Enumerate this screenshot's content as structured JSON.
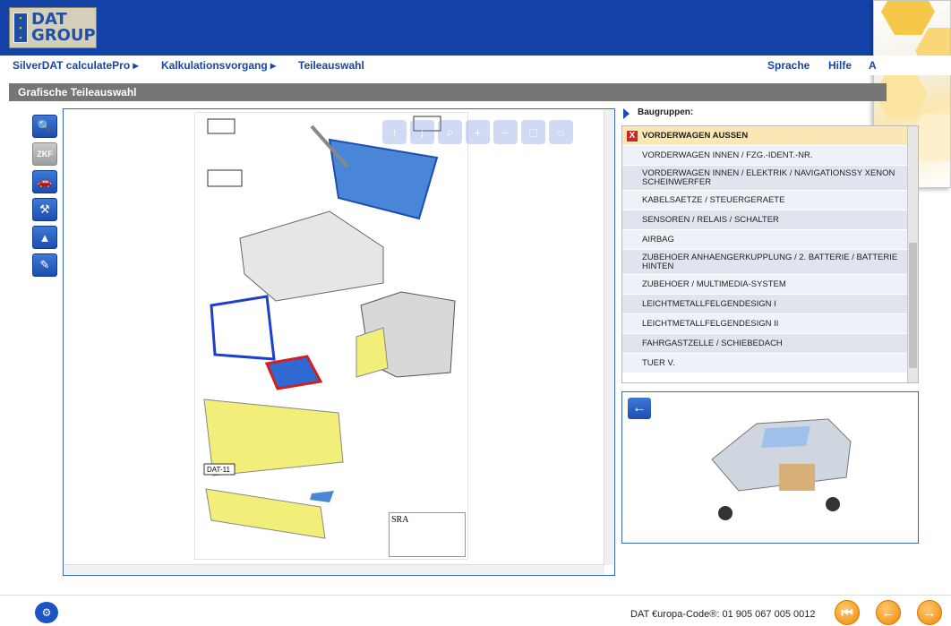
{
  "header": {
    "logo_line1": "DAT",
    "logo_line2": "GROUP"
  },
  "nav": {
    "breadcrumb": [
      "SilverDAT calculatePro ▸",
      "Kalkulationsvorgang ▸",
      "Teileauswahl"
    ],
    "right": [
      "Sprache",
      "Hilfe",
      "A"
    ]
  },
  "section_title": "Grafische Teileauswahl",
  "toolbar": {
    "tools": [
      "magnifier-icon",
      "zkf-icon",
      "car-side-icon",
      "hammer-icon",
      "landscape-icon",
      "repair-icon"
    ],
    "zkf_label": "ZKF"
  },
  "viewer": {
    "sra_label": "SRA",
    "plate_label": "DAT-11"
  },
  "groups": {
    "header": "Baugruppen:",
    "items": [
      {
        "label": "VORDERWAGEN AUSSEN",
        "selected": true
      },
      {
        "label": "VORDERWAGEN INNEN / FZG.-IDENT.-NR."
      },
      {
        "label": "VORDERWAGEN INNEN / ELEKTRIK / NAVIGATIONSSY XENON SCHEINWERFER"
      },
      {
        "label": "KABELSAETZE / STEUERGERAETE"
      },
      {
        "label": "SENSOREN / RELAIS / SCHALTER"
      },
      {
        "label": "AIRBAG"
      },
      {
        "label": "ZUBEHOER ANHAENGERKUPPLUNG / 2. BATTERIE / BATTERIE HINTEN"
      },
      {
        "label": "ZUBEHOER / MULTIMEDIA-SYSTEM"
      },
      {
        "label": "LEICHTMETALLFELGENDESIGN I"
      },
      {
        "label": "LEICHTMETALLFELGENDESIGN II"
      },
      {
        "label": "FAHRGASTZELLE / SCHIEBEDACH"
      },
      {
        "label": "TUER V."
      }
    ]
  },
  "footer": {
    "europa_code": "DAT €uropa-Code®: 01 905 067 005 0012"
  },
  "colors": {
    "brand_blue": "#1343a6",
    "highlight_yellow": "#f1ee7a",
    "selected_blue": "#4a86d8",
    "selected_red": "#d21f1f"
  }
}
